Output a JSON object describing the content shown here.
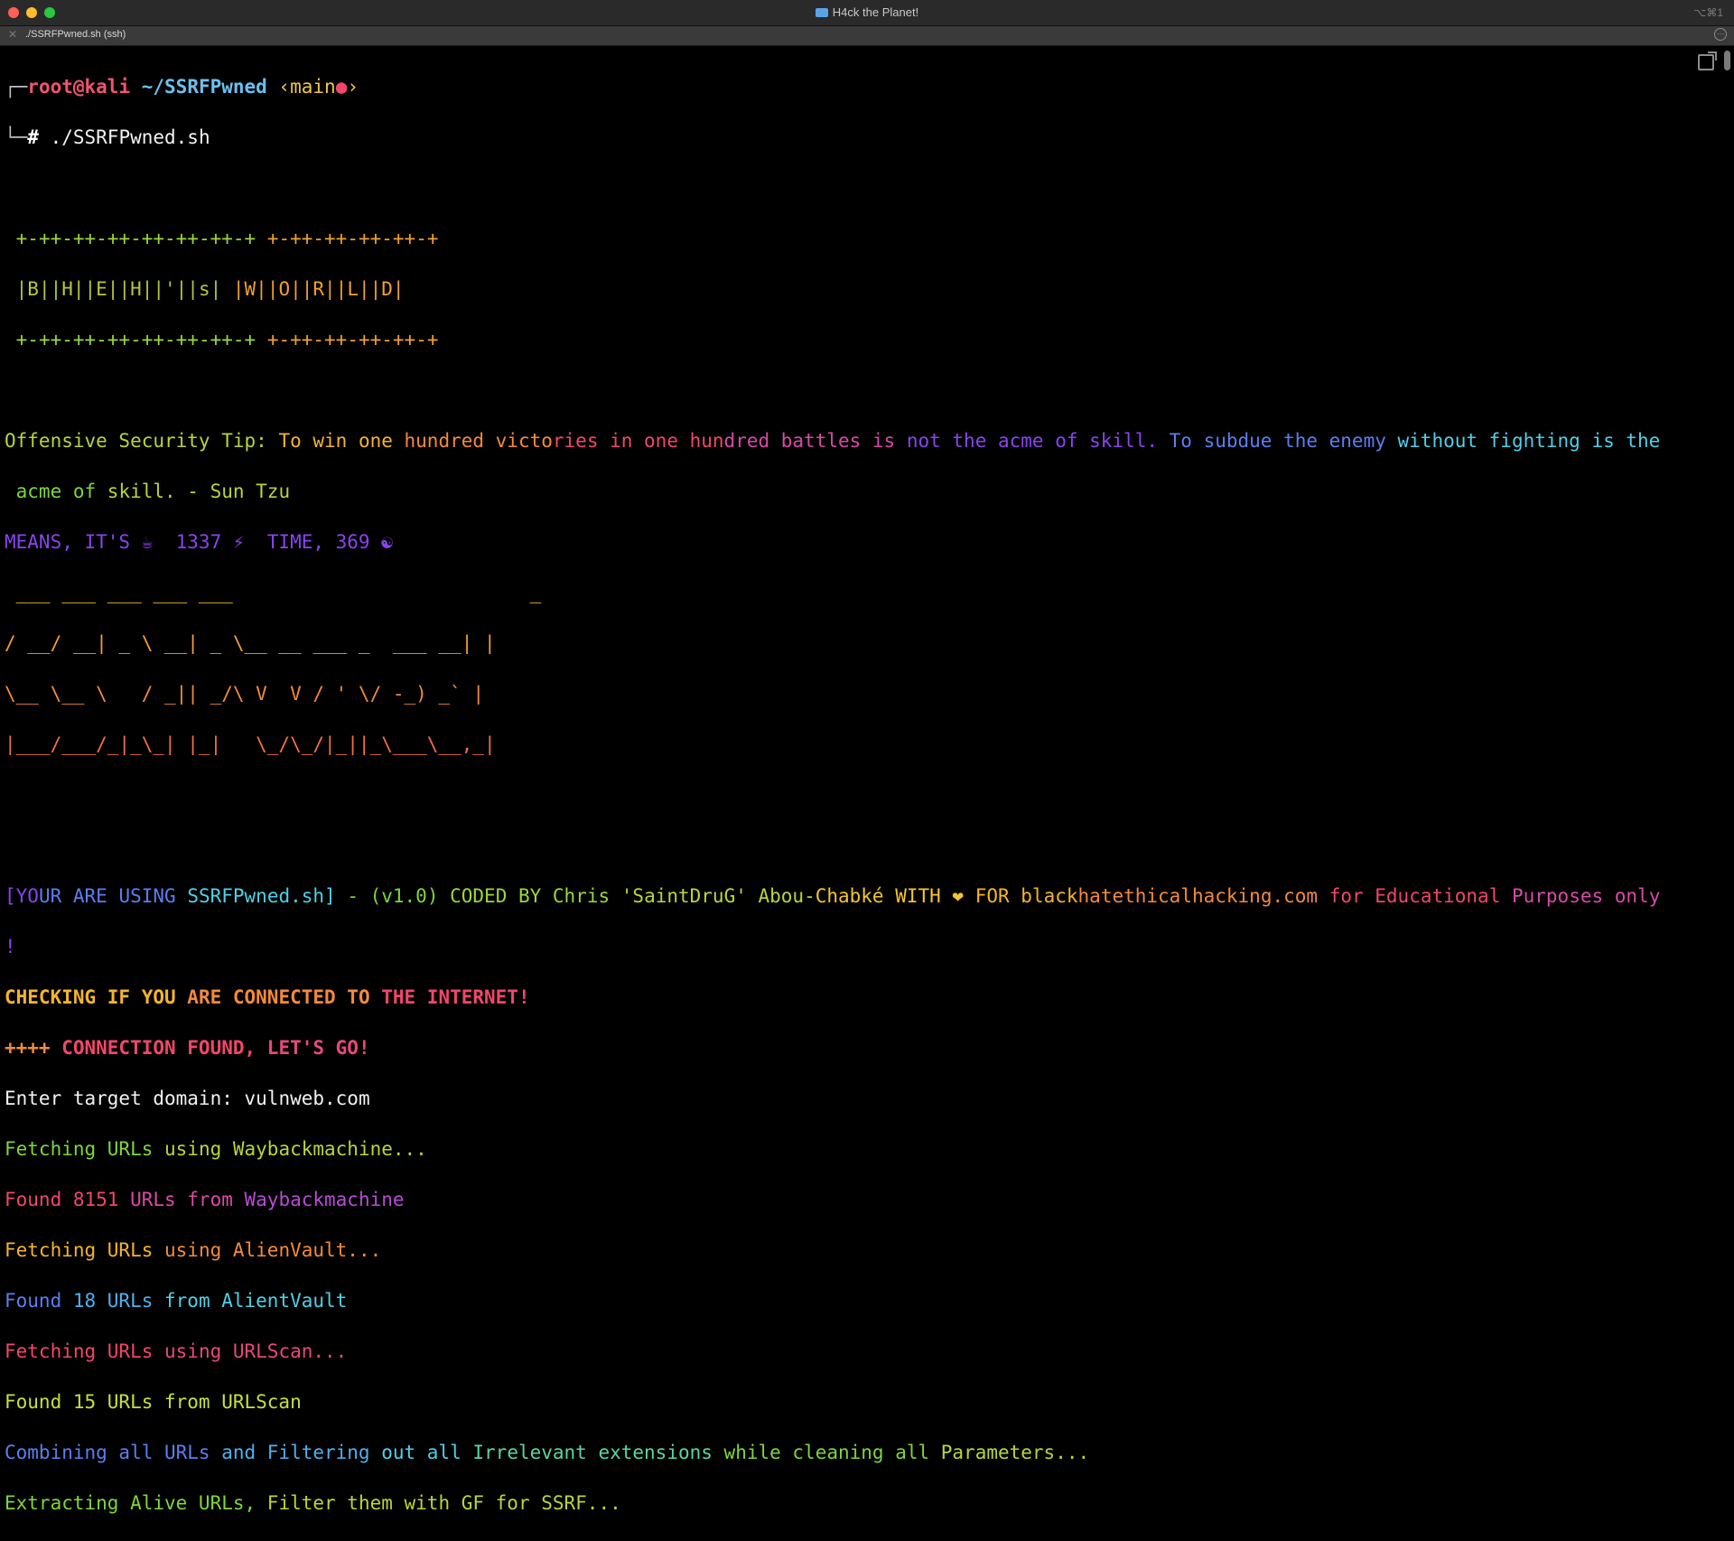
{
  "window": {
    "title": "H4ck the Planet!",
    "shortcut": "⌥⌘1"
  },
  "tab": {
    "label": "./SSRFPwned.sh (ssh)"
  },
  "prompt": {
    "user": "root@kali",
    "path": "~/SSRFPwned",
    "branch_open": "‹main",
    "branch_dot": "●",
    "branch_close": "›",
    "command": "./SSRFPwned.sh"
  },
  "banner": {
    "border1": "+-++-++-++-++-++-++-+",
    "word1": "|B||H||E||H||'||s|",
    "word2": "|W||O||R||L||D|",
    "border2": "+-++-++-++-++-+"
  },
  "tip": {
    "p1": "Offensive Security Tip:",
    "p2": " To win one ",
    "p3": "hundred victo",
    "p4": "ries in one hun",
    "p5": "dred battles is ",
    "p6": "not the acme of skill. ",
    "p7": "To subdue the enemy ",
    "p8": "without fighting is the",
    "l2a": " acme of ",
    "l2b": "skill. - Sun Tzu"
  },
  "means": {
    "text": "MEANS, IT'S ☕  1337 ⚡  TIME, 369 ☯"
  },
  "ascii_art": {
    "l1": " ___ ___ ___ ___ ___                          _",
    "l2": "/ __/ __| _ \\ __| _ \\__ __ ___ _  ___ __| |",
    "l3": "\\__ \\__ \\   / _|| _/\\ V  V / ' \\/ -_) _` |",
    "l4": "|___/___/_|_\\_| |_|   \\_/\\_/|_||_\\___\\__,_|"
  },
  "using": {
    "p1": "[YO",
    "p2": "UR ARE USING ",
    "p3": "SSRFPwned.sh] ",
    "p4": "- (v1.0) ",
    "p5": "CODED BY Chris ",
    "p6": "'SaintDruG' Abou-",
    "p7": "Chabké WITH ❤ ",
    "p8": "FOR black",
    "p9": "hatethicalhacking.com ",
    "p10": "for Educational ",
    "p11": "Purposes only",
    "excl": "!"
  },
  "checking": {
    "p1": "CHECKING IF YOU ",
    "p2": "ARE CONNECTED TO ",
    "p3": "THE INTERNET!"
  },
  "found_conn": {
    "p1": "++++ ",
    "p2": "CONNECTION FOUND, ",
    "p3": "LET'S GO!"
  },
  "input": {
    "label": "Enter target domain: ",
    "value": "vulnweb.com"
  },
  "log": {
    "f1a": "Fetching URLs ",
    "f1b": "using Waybackmachine...",
    "w1a": "Found 8151 ",
    "w1b": "URLs from ",
    "w1c": "Waybackmachine",
    "f2a": "Fetching URLs ",
    "f2b": "using AlienVault...",
    "w2a": "Found ",
    "w2b": "18 URLs ",
    "w2c": "from AlientVault",
    "f3a": "Fetching URLs ",
    "f3b": "using URLScan...",
    "w3": "Found 15 URLs from URLScan",
    "c1": "Combining all URLs ",
    "c2": "and Filtering ",
    "c3": "out all ",
    "c4": "Irrelevant extensions ",
    "c5": "while cleaning all ",
    "c6": "Parameters...",
    "e1": "Extracting Alive URLs, ",
    "e2": "Filter them with GF for SSRF..."
  },
  "colors": {
    "green": "#7dd63d",
    "orange": "#f29b2a",
    "red": "#f2466a",
    "purple": "#8a43ef",
    "blue": "#5a7ff2",
    "cyan": "#4fd0e8"
  }
}
